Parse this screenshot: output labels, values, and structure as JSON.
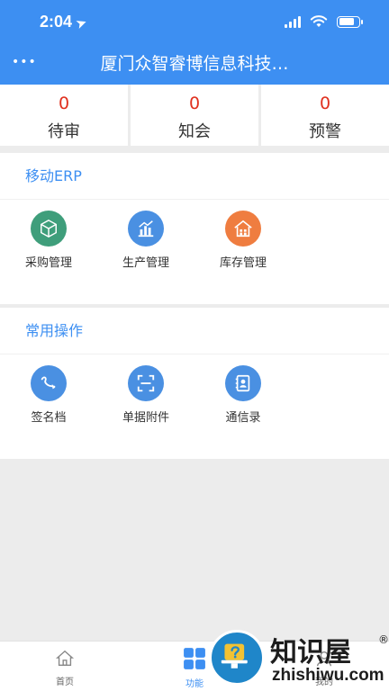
{
  "status_bar": {
    "time": "2:04"
  },
  "header": {
    "title": "厦门众智睿博信息科技…"
  },
  "counters": [
    {
      "value": "0",
      "label": "待审"
    },
    {
      "value": "0",
      "label": "知会"
    },
    {
      "value": "0",
      "label": "预警"
    }
  ],
  "sections": {
    "erp": {
      "title": "移动ERP",
      "items": [
        {
          "label": "采购管理",
          "icon": "box-icon",
          "color": "#3f9e7b"
        },
        {
          "label": "生产管理",
          "icon": "chart-icon",
          "color": "#4a90e2"
        },
        {
          "label": "库存管理",
          "icon": "warehouse-icon",
          "color": "#ef7d40"
        }
      ]
    },
    "common": {
      "title": "常用操作",
      "items": [
        {
          "label": "签名档",
          "icon": "signature-icon",
          "color": "#4a90e2"
        },
        {
          "label": "单据附件",
          "icon": "scan-icon",
          "color": "#4a90e2"
        },
        {
          "label": "通信录",
          "icon": "contacts-icon",
          "color": "#4a90e2"
        }
      ]
    }
  },
  "tabbar": {
    "tabs": [
      {
        "label": "首页",
        "icon": "home-icon"
      },
      {
        "label": "功能",
        "icon": "grid-icon",
        "active": true
      },
      {
        "label": "我的",
        "icon": "user-icon"
      }
    ]
  },
  "watermark": {
    "text": "知识屋",
    "reg": "®",
    "domain": "zhishiwu.com"
  },
  "colors": {
    "primary": "#3d8ff2",
    "counter": "#e0301e",
    "background": "#ececec"
  }
}
